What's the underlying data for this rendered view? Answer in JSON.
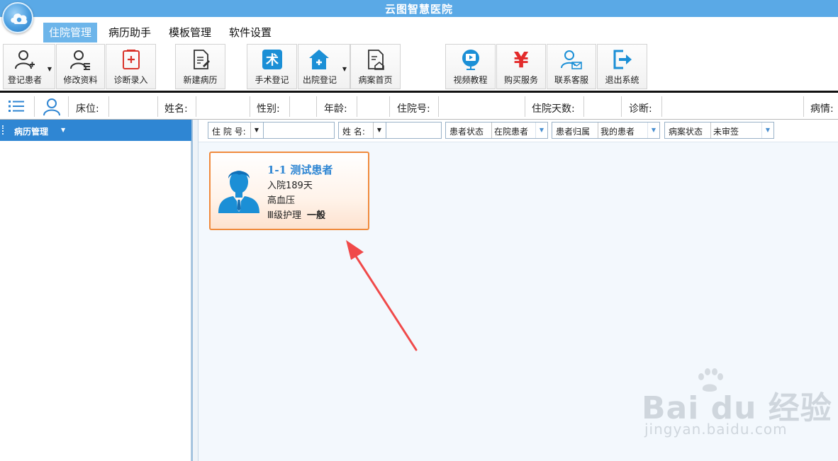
{
  "window": {
    "title": "云图智慧医院"
  },
  "menu": [
    {
      "label": "住院管理",
      "active": true
    },
    {
      "label": "病历助手",
      "active": false
    },
    {
      "label": "模板管理",
      "active": false
    },
    {
      "label": "软件设置",
      "active": false
    }
  ],
  "toolbar": {
    "register_patient": "登记患者",
    "edit_info": "修改资料",
    "diagnosis_entry": "诊断录入",
    "new_record": "新建病历",
    "surgery_register": "手术登记",
    "discharge_register": "出院登记",
    "record_homepage": "病案首页",
    "video_tutorial": "视频教程",
    "buy_service": "购买服务",
    "contact_support": "联系客服",
    "exit_system": "退出系统",
    "surgery_icon_glyph": "术",
    "price_icon_glyph": "¥"
  },
  "infobar": {
    "bed": "床位:",
    "name": "姓名:",
    "gender": "性别:",
    "age": "年龄:",
    "admission_no": "住院号:",
    "days": "住院天数:",
    "diagnosis": "诊断:",
    "condition": "病情:"
  },
  "left_panel": {
    "title": "病历管理"
  },
  "filters": {
    "admission_no_label": "住 院 号:",
    "admission_no_value": "",
    "name_label": "姓 名:",
    "name_value": "",
    "patient_status_label": "患者状态",
    "patient_status_value": "在院患者",
    "patient_owner_label": "患者归属",
    "patient_owner_value": "我的患者",
    "record_status_label": "病案状态",
    "record_status_value": "未审签"
  },
  "patient_card": {
    "title": "1-1 测试患者",
    "days": "入院189天",
    "diagnosis": "高血压",
    "care_level": "Ⅲ级护理",
    "condition": "一般"
  },
  "watermark": {
    "brand": "Bai du 经验",
    "url": "jingyan.baidu.com"
  },
  "colors": {
    "title_bar": "#5aa9e6",
    "menu_active": "#6db5ea",
    "panel_header": "#2f86d3",
    "card_border": "#f08a3c",
    "arrow": "#f04a4a",
    "surgery_icon": "#1b8fd6",
    "price_icon": "#e32b2b"
  }
}
